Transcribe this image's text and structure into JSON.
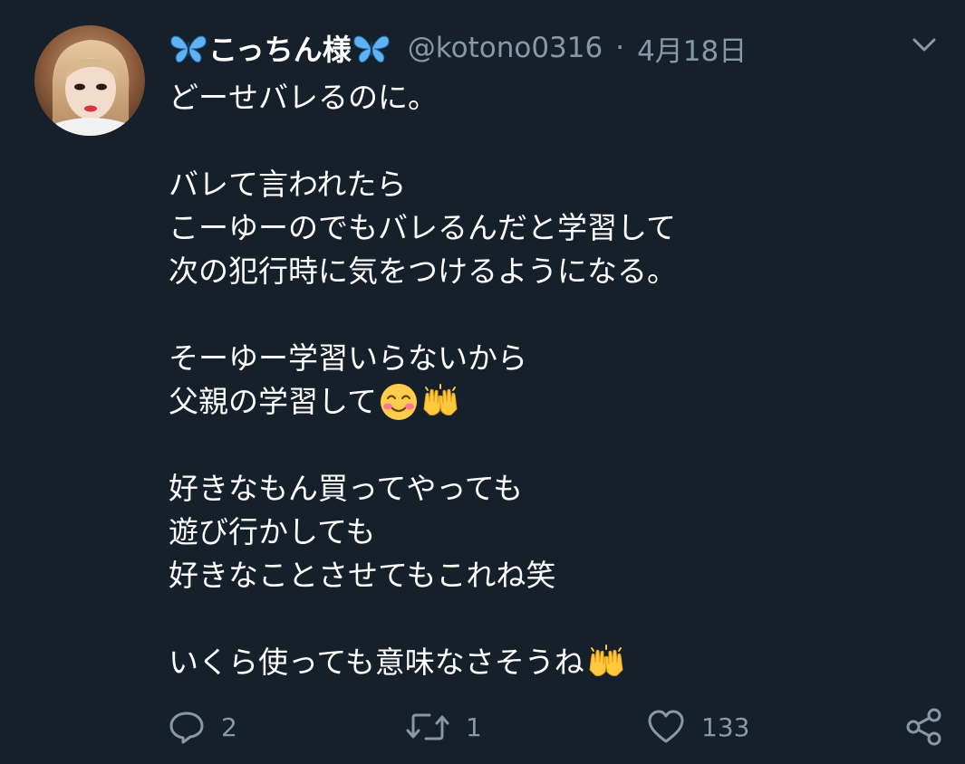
{
  "tweet": {
    "author": {
      "display_name": "こっちん様",
      "handle": "@kotono0316",
      "avatar_icon": "profile-photo"
    },
    "separator": "·",
    "date": "4月18日",
    "lines": [
      "どーせバレるのに。",
      "",
      "バレて言われたら",
      "こーゆーのでもバレるんだと学習して",
      "次の犯行時に気をつけるようになる。",
      "",
      "そーゆー学習いらないから",
      "父親の学習して",
      "",
      "好きなもん買ってやっても",
      "遊び行かしても",
      "好きなことさせてもこれね笑",
      "",
      "いくら使っても意味なさそうね"
    ],
    "emojis": {
      "name_decoration": "butterfly",
      "line8": [
        "smiling-face-with-blush",
        "raising-hands"
      ],
      "line14": [
        "raising-hands"
      ]
    },
    "actions": {
      "reply_count": "2",
      "retweet_count": "1",
      "like_count": "133"
    }
  },
  "colors": {
    "background": "#15202b",
    "text_primary": "#ffffff",
    "text_secondary": "#8899a6",
    "butterfly": "#5fb3f5"
  }
}
